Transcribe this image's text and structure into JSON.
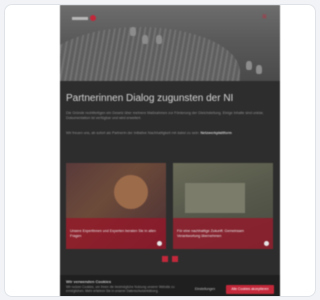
{
  "page": {
    "headline": "Partnerinnen Dialog zugunsten der NI",
    "paragraph_1": "Die Gründe rechtfertigen ein Gesetz über mehrere Maßnahmen zur Förderung der Gleichstellung. Einige Inhalte sind unklar, Dokumentation ist verfügbar und wird erweitert.",
    "paragraph_2_prefix": "Wir freuen uns, ab sofort als Partnerin der Initiative Nachhaltigkeit mit dabei zu sein: ",
    "paragraph_2_link": "Netzwerkplattform",
    "tiles": [
      {
        "caption": "Unsere Expertinnen und Experten beraten Sie in allen Fragen",
        "arrow": "→"
      },
      {
        "caption": "Für eine nachhaltige Zukunft: Gemeinsam Verantwortung übernehmen",
        "arrow": "→"
      }
    ],
    "cookie": {
      "title": "Wir verwenden Cookies",
      "text": "Wir nutzen Cookies, um Ihnen die bestmögliche Nutzung unserer Website zu ermöglichen. Mehr erfahren Sie in unserer Datenschutzerklärung.",
      "settings_label": "Einstellungen",
      "accept_label": "Alle Cookies akzeptieren"
    },
    "menu_icon": "≡"
  },
  "colors": {
    "accent": "#c2283a",
    "background": "#2d2d2d"
  }
}
